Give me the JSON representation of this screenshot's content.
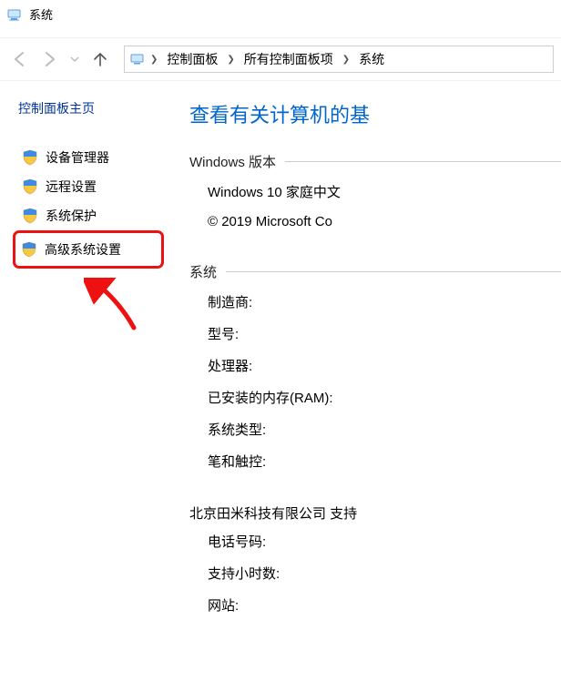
{
  "window": {
    "title": "系统"
  },
  "breadcrumb": {
    "items": [
      "控制面板",
      "所有控制面板项",
      "系统"
    ]
  },
  "sidebar": {
    "home": "控制面板主页",
    "items": [
      {
        "label": "设备管理器"
      },
      {
        "label": "远程设置"
      },
      {
        "label": "系统保护"
      },
      {
        "label": "高级系统设置"
      }
    ]
  },
  "main": {
    "heading": "查看有关计算机的基",
    "windows_edition": {
      "legend": "Windows 版本",
      "lines": [
        "Windows 10 家庭中文",
        "© 2019 Microsoft Co"
      ]
    },
    "system": {
      "legend": "系统",
      "rows": [
        "制造商:",
        "型号:",
        "处理器:",
        "已安装的内存(RAM):",
        "系统类型:",
        "笔和触控:"
      ]
    },
    "support": {
      "line": "北京田米科技有限公司 支持",
      "rows": [
        "电话号码:",
        "支持小时数:",
        "网站:"
      ]
    }
  }
}
